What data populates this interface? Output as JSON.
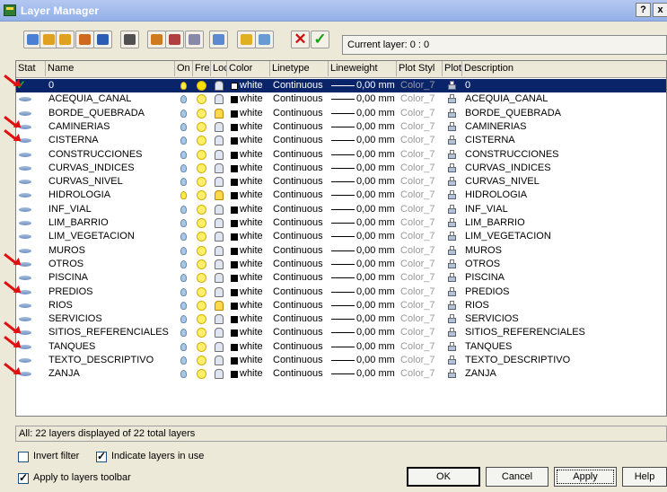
{
  "window": {
    "title": "Layer Manager",
    "help_button": "?",
    "close_button": "x"
  },
  "toolbar": {
    "current_layer_text": "Current layer: 0 : 0",
    "tools": [
      {
        "name": "new-state-tool",
        "color": "#4a7fd4"
      },
      {
        "name": "restore-state-tool",
        "color": "#e0a020"
      },
      {
        "name": "import-tool",
        "color": "#e0a020"
      },
      {
        "name": "export-tool",
        "color": "#d06820"
      },
      {
        "name": "save-tool",
        "color": "#2c5cb4"
      },
      {
        "name": "binoculars-tool",
        "color": "#505050"
      },
      {
        "name": "layer-states-tool",
        "color": "#d07a20"
      },
      {
        "name": "layer-filter-tool",
        "color": "#b04040"
      },
      {
        "name": "layer-delete-filter-tool",
        "color": "#8888aa"
      },
      {
        "name": "layer-properties-tool",
        "color": "#5c8ad0"
      },
      {
        "name": "new-layer-tool",
        "color": "#e0b020"
      },
      {
        "name": "new-layer-vp-tool",
        "color": "#6a9ad4"
      }
    ],
    "delete_symbol": "✕",
    "apply_symbol": "✓"
  },
  "columns": [
    "Stat",
    "Name",
    "On",
    "Fre",
    "Loc",
    "Color",
    "Linetype",
    "Lineweight",
    "Plot Styl",
    "Plot",
    "Description"
  ],
  "layers": [
    {
      "name": "0",
      "on": true,
      "frozen": false,
      "locked": false,
      "color": "white",
      "linetype": "Continuous",
      "lineweight": "0,00 mm",
      "plot_style": "Color_7",
      "description": "0",
      "current": true,
      "selected": true,
      "bulb_lit": true,
      "sun_frozen": true,
      "lock_open": false
    },
    {
      "name": "ACEQUIA_CANAL",
      "color": "white",
      "linetype": "Continuous",
      "lineweight": "0,00 mm",
      "plot_style": "Color_7",
      "description": "ACEQUIA_CANAL",
      "lock_open": false
    },
    {
      "name": "BORDE_QUEBRADA",
      "color": "white",
      "linetype": "Continuous",
      "lineweight": "0,00 mm",
      "plot_style": "Color_7",
      "description": "BORDE_QUEBRADA",
      "lock_open": true
    },
    {
      "name": "CAMINERIAS",
      "color": "white",
      "linetype": "Continuous",
      "lineweight": "0,00 mm",
      "plot_style": "Color_7",
      "description": "CAMINERIAS",
      "lock_open": false
    },
    {
      "name": "CISTERNA",
      "color": "white",
      "linetype": "Continuous",
      "lineweight": "0,00 mm",
      "plot_style": "Color_7",
      "description": "CISTERNA",
      "lock_open": false
    },
    {
      "name": "CONSTRUCCIONES",
      "color": "white",
      "linetype": "Continuous",
      "lineweight": "0,00 mm",
      "plot_style": "Color_7",
      "description": "CONSTRUCCIONES",
      "lock_open": false
    },
    {
      "name": "CURVAS_INDICES",
      "color": "white",
      "linetype": "Continuous",
      "lineweight": "0,00 mm",
      "plot_style": "Color_7",
      "description": "CURVAS_INDICES",
      "lock_open": false
    },
    {
      "name": "CURVAS_NIVEL",
      "color": "white",
      "linetype": "Continuous",
      "lineweight": "0,00 mm",
      "plot_style": "Color_7",
      "description": "CURVAS_NIVEL",
      "lock_open": false
    },
    {
      "name": "HIDROLOGIA",
      "color": "white",
      "linetype": "Continuous",
      "lineweight": "0,00 mm",
      "plot_style": "Color_7",
      "description": "HIDROLOGIA",
      "lock_open": true,
      "bulb_lit": true
    },
    {
      "name": "INF_VIAL",
      "color": "white",
      "linetype": "Continuous",
      "lineweight": "0,00 mm",
      "plot_style": "Color_7",
      "description": "INF_VIAL",
      "lock_open": false
    },
    {
      "name": "LIM_BARRIO",
      "color": "white",
      "linetype": "Continuous",
      "lineweight": "0,00 mm",
      "plot_style": "Color_7",
      "description": "LIM_BARRIO",
      "lock_open": false
    },
    {
      "name": "LIM_VEGETACION",
      "color": "white",
      "linetype": "Continuous",
      "lineweight": "0,00 mm",
      "plot_style": "Color_7",
      "description": "LIM_VEGETACION",
      "lock_open": false
    },
    {
      "name": "MUROS",
      "color": "white",
      "linetype": "Continuous",
      "lineweight": "0,00 mm",
      "plot_style": "Color_7",
      "description": "MUROS",
      "lock_open": false
    },
    {
      "name": "OTROS",
      "color": "white",
      "linetype": "Continuous",
      "lineweight": "0,00 mm",
      "plot_style": "Color_7",
      "description": "OTROS",
      "lock_open": false
    },
    {
      "name": "PISCINA",
      "color": "white",
      "linetype": "Continuous",
      "lineweight": "0,00 mm",
      "plot_style": "Color_7",
      "description": "PISCINA",
      "lock_open": false
    },
    {
      "name": "PREDIOS",
      "color": "white",
      "linetype": "Continuous",
      "lineweight": "0,00 mm",
      "plot_style": "Color_7",
      "description": "PREDIOS",
      "lock_open": false
    },
    {
      "name": "RIOS",
      "color": "white",
      "linetype": "Continuous",
      "lineweight": "0,00 mm",
      "plot_style": "Color_7",
      "description": "RIOS",
      "lock_open": true
    },
    {
      "name": "SERVICIOS",
      "color": "white",
      "linetype": "Continuous",
      "lineweight": "0,00 mm",
      "plot_style": "Color_7",
      "description": "SERVICIOS",
      "lock_open": false
    },
    {
      "name": "SITIOS_REFERENCIALES",
      "color": "white",
      "linetype": "Continuous",
      "lineweight": "0,00 mm",
      "plot_style": "Color_7",
      "description": "SITIOS_REFERENCIALES",
      "lock_open": false
    },
    {
      "name": "TANQUES",
      "color": "white",
      "linetype": "Continuous",
      "lineweight": "0,00 mm",
      "plot_style": "Color_7",
      "description": "TANQUES",
      "lock_open": false
    },
    {
      "name": "TEXTO_DESCRIPTIVO",
      "color": "white",
      "linetype": "Continuous",
      "lineweight": "0,00 mm",
      "plot_style": "Color_7",
      "description": "TEXTO_DESCRIPTIVO",
      "lock_open": false
    },
    {
      "name": "ZANJA",
      "color": "white",
      "linetype": "Continuous",
      "lineweight": "0,00 mm",
      "plot_style": "Color_7",
      "description": "ZANJA",
      "lock_open": false
    }
  ],
  "annotation_arrow_rows": [
    0,
    3,
    4,
    13,
    15,
    18,
    19,
    21
  ],
  "status_text": "All: 22 layers displayed of 22 total layers",
  "options": {
    "invert_filter": {
      "label": "Invert filter",
      "checked": false
    },
    "indicate_in_use": {
      "label": "Indicate layers in use",
      "checked": true
    },
    "apply_to_toolbar": {
      "label": "Apply to layers toolbar",
      "checked": true
    }
  },
  "buttons": {
    "ok": "OK",
    "cancel": "Cancel",
    "apply": "Apply",
    "help": "Help"
  },
  "colors": {
    "selection": "#0a246a",
    "annotation_arrow": "#e01010",
    "dialog_bg": "#ece9d8"
  }
}
